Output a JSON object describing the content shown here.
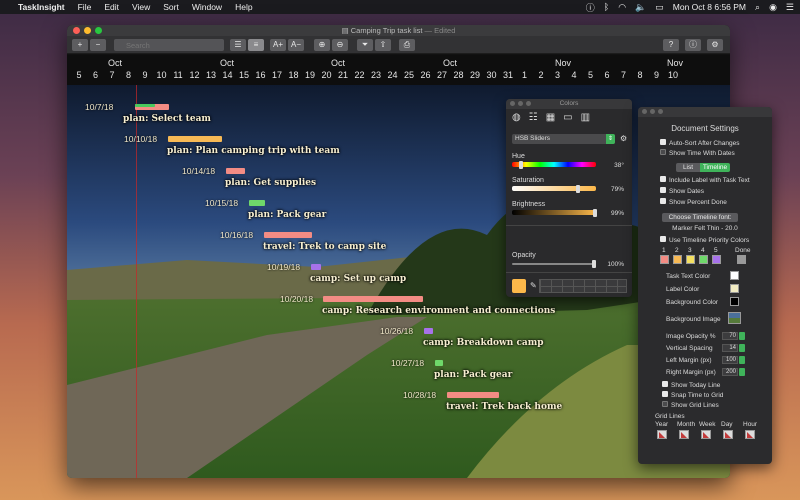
{
  "menubar": {
    "app_name": "TaskInsight",
    "items": [
      "File",
      "Edit",
      "View",
      "Sort",
      "Window",
      "Help"
    ],
    "clock": "Mon Oct 8  6:56 PM"
  },
  "window": {
    "title": "Camping Trip task list",
    "title_suffix": "— Edited"
  },
  "toolbar": {
    "search_placeholder": "Search",
    "add_label": "+",
    "remove_label": "−",
    "font_up_label": "A+",
    "font_down_label": "A−",
    "help_label": "?"
  },
  "timeline": {
    "months": [
      "Oct",
      "Oct",
      "Oct",
      "Oct",
      "Nov",
      "Nov"
    ],
    "days": [
      "5",
      "6",
      "7",
      "8",
      "9",
      "10",
      "11",
      "12",
      "13",
      "14",
      "15",
      "16",
      "17",
      "18",
      "19",
      "20",
      "21",
      "22",
      "23",
      "24",
      "25",
      "26",
      "27",
      "28",
      "29",
      "30",
      "31",
      "1",
      "2",
      "3",
      "4",
      "5",
      "6",
      "7",
      "8",
      "9",
      "10"
    ],
    "tasks": [
      {
        "date": "10/7/18",
        "label": "plan: Select team",
        "color": "#f38c84",
        "progress": 0.6,
        "progress_color": "#49c95d"
      },
      {
        "date": "10/10/18",
        "label": "plan: Plan camping trip with team",
        "color": "#f7b955"
      },
      {
        "date": "10/14/18",
        "label": "plan: Get supplies",
        "color": "#f38c84"
      },
      {
        "date": "10/15/18",
        "label": "plan: Pack gear",
        "color": "#6fd86a"
      },
      {
        "date": "10/16/18",
        "label": "travel: Trek to camp site",
        "color": "#f38c84"
      },
      {
        "date": "10/19/18",
        "label": "camp: Set up camp",
        "color": "#a772ea"
      },
      {
        "date": "10/20/18",
        "label": "camp: Research environment and connections",
        "color": "#f38c84"
      },
      {
        "date": "10/26/18",
        "label": "camp: Breakdown camp",
        "color": "#a772ea"
      },
      {
        "date": "10/27/18",
        "label": "plan: Pack gear",
        "color": "#6fd86a"
      },
      {
        "date": "10/28/18",
        "label": "travel: Trek back home",
        "color": "#f38c84"
      }
    ]
  },
  "colors_panel": {
    "title": "Colors",
    "mode": "HSB Sliders",
    "hue_label": "Hue",
    "hue_value": "38°",
    "saturation_label": "Saturation",
    "saturation_value": "79%",
    "brightness_label": "Brightness",
    "brightness_value": "99%",
    "opacity_label": "Opacity",
    "opacity_value": "100%",
    "selected_color": "#fcb84a",
    "hue_level": 0.106,
    "saturation_level": 0.79,
    "brightness_level": 0.99,
    "opacity_level": 1.0
  },
  "settings": {
    "title": "Document Settings",
    "auto_sizes": "Auto-Sort After Changes",
    "show_time": "Show Time With Dates",
    "tab_list": "List",
    "tab_timeline": "Timeline",
    "include_label": "Include Label with Task Text",
    "show_dates": "Show Dates",
    "show_percent": "Show Percent Done",
    "choose_font": "Choose Timeline font:",
    "font_name": "Marker Felt Thin - 20.0",
    "use_priority": "Use Timeline Priority Colors",
    "priority_labels": [
      "1",
      "2",
      "3",
      "4",
      "5",
      "Done"
    ],
    "priority_colors": [
      "#f38c84",
      "#f7b955",
      "#f4e062",
      "#6fd86a",
      "#a772ea",
      "#9a9a9a"
    ],
    "task_text_color": "Task Text Color",
    "label_color": "Label Color",
    "background_color": "Background Color",
    "background_image": "Background Image",
    "image_opacity_label": "Image Opacity %",
    "image_opacity": "70",
    "vertical_spacing_label": "Vertical Spacing",
    "vertical_spacing": "14",
    "left_margin_label": "Left Margin (px)",
    "left_margin": "100",
    "right_margin_label": "Right Margin (px)",
    "right_margin": "200",
    "show_today": "Show Today Line",
    "snap_time": "Snap Time to Grid",
    "show_grid": "Show Grid Lines",
    "grid_lines_title": "Grid Lines",
    "grid_labels": [
      "Year",
      "Month",
      "Week",
      "Day",
      "Hour"
    ]
  }
}
